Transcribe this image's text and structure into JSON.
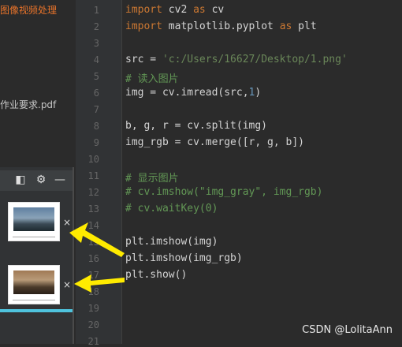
{
  "project_panel": {
    "title": "图像视频处理",
    "pdf_file": "作业要求.pdf"
  },
  "plots_panel": {
    "toolbar": {
      "icons": [
        "window-icon",
        "gear-icon",
        "minimize-icon"
      ]
    },
    "thumbnails": [
      {
        "close_label": "×"
      },
      {
        "close_label": "×"
      }
    ]
  },
  "editor": {
    "line_numbers": [
      "1",
      "2",
      "3",
      "4",
      "5",
      "6",
      "7",
      "8",
      "9",
      "10",
      "11",
      "12",
      "13",
      "14",
      "15",
      "16",
      "17",
      "18",
      "19",
      "20",
      "21"
    ],
    "lines": [
      "import cv2 as cv",
      "import matplotlib.pyplot as plt",
      "",
      "src = 'c:/Users/16627/Desktop/1.png'",
      "# 读入图片",
      "img = cv.imread(src,1)",
      "",
      "b, g, r = cv.split(img)",
      "img_rgb = cv.merge([r, g, b])",
      "",
      "# 显示图片",
      "# cv.imshow(\"img_gray\", img_rgb)",
      "# cv.waitKey(0)",
      "",
      "plt.imshow(img)",
      "plt.imshow(img_rgb)",
      "plt.show()",
      "",
      "",
      "",
      ""
    ]
  },
  "watermark": "CSDN @LolitaAnn",
  "colors": {
    "arrow": "#ffeb00",
    "accent": "#4fc3dd"
  }
}
